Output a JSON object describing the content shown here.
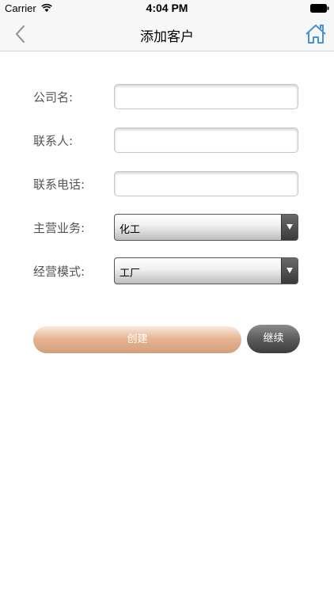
{
  "status_bar": {
    "carrier": "Carrier",
    "time": "4:04 PM"
  },
  "nav": {
    "title": "添加客户",
    "back_icon": "chevron-left-icon",
    "home_icon": "home-icon",
    "accent_color": "#4a90d9"
  },
  "form": {
    "company": {
      "label": "公司名:",
      "value": ""
    },
    "contact": {
      "label": "联系人:",
      "value": ""
    },
    "phone": {
      "label": "联系电话:",
      "value": ""
    },
    "business": {
      "label": "主营业务:",
      "selected": "化工"
    },
    "mode": {
      "label": "经营模式:",
      "selected": "工厂"
    }
  },
  "buttons": {
    "create_label": "创建",
    "continue_label": "继续",
    "create_color": "#e2b08e",
    "continue_color": "#555555"
  }
}
